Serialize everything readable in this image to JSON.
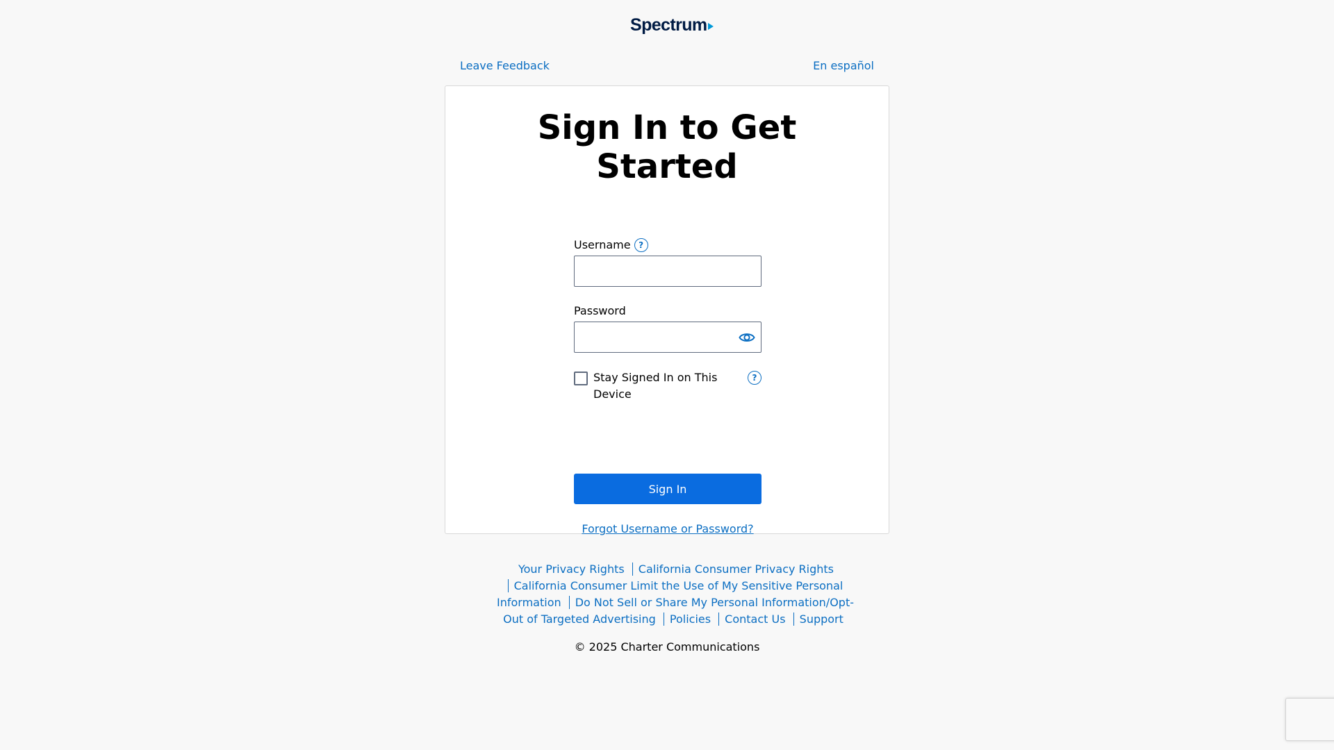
{
  "brand": {
    "name": "Spectrum",
    "accent": "#0099d8",
    "navy": "#001b44"
  },
  "top_links": {
    "feedback": "Leave Feedback",
    "language": "En español"
  },
  "card": {
    "title_line1": "Sign In to Get",
    "title_line2": "Started"
  },
  "form": {
    "username_label": "Username",
    "username_value": "",
    "password_label": "Password",
    "password_value": "",
    "stay_signed_in_label": "Stay Signed In on This Device",
    "stay_signed_in_checked": false,
    "signin_label": "Sign In",
    "forgot_label": "Forgot Username or Password?",
    "help_glyph": "?"
  },
  "footer": {
    "links": [
      "Your Privacy Rights",
      "California Consumer Privacy Rights",
      "California Consumer Limit the Use of My Sensitive Personal Information",
      "Do Not Sell or Share My Personal Information/Opt-Out of Targeted Advertising",
      "Policies",
      "Contact Us",
      "Support"
    ],
    "copyright": "© 2025 Charter Communications"
  },
  "colors": {
    "link": "#0b6ec2",
    "button": "#0a6ce0",
    "background": "#f8f8f8"
  }
}
